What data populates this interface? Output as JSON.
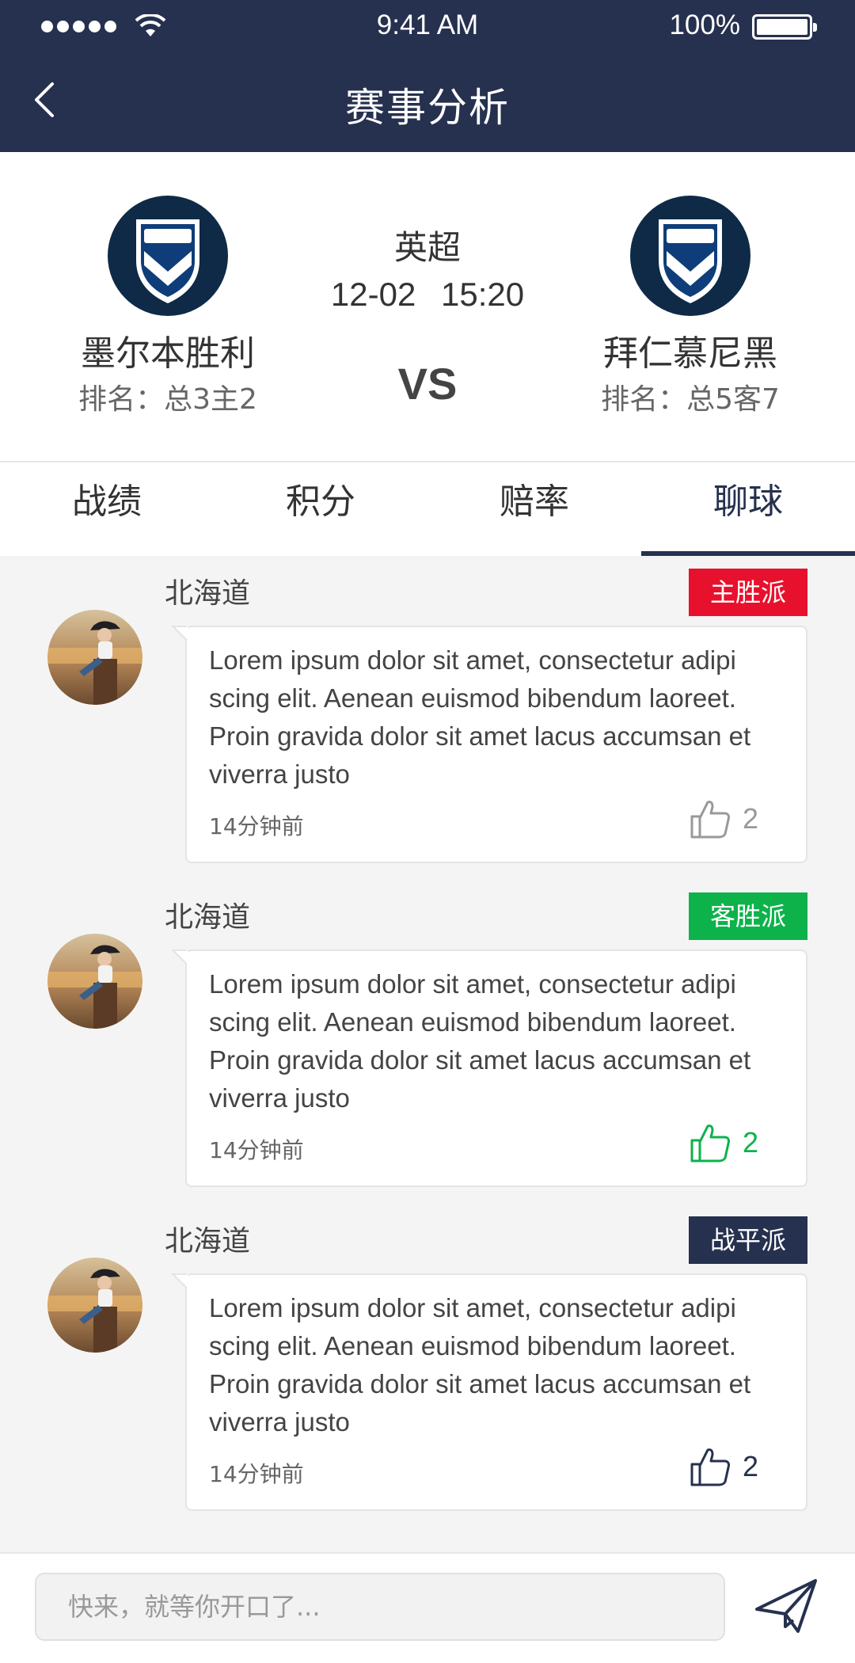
{
  "status_bar": {
    "time": "9:41 AM",
    "battery": "100%"
  },
  "nav": {
    "title": "赛事分析"
  },
  "match": {
    "league": "英超",
    "date": "12-02",
    "time": "15:20",
    "vs": "VS",
    "home": {
      "name": "墨尔本胜利",
      "rank": "排名：总3主2"
    },
    "away": {
      "name": "拜仁慕尼黑",
      "rank": "排名：总5客7"
    }
  },
  "tabs": [
    {
      "label": "战绩"
    },
    {
      "label": "积分"
    },
    {
      "label": "赔率"
    },
    {
      "label": "聊球",
      "active": true
    }
  ],
  "comments": [
    {
      "user": "北海道",
      "badge": "主胜派",
      "badge_color": "#e8112d",
      "text": "Lorem ipsum dolor sit amet, consectetur adipi scing elit. Aenean euismod bibendum laoreet. Proin gravida dolor sit amet lacus accumsan et viverra justo",
      "time": "14分钟前",
      "likes": "2",
      "like_color": "#999999"
    },
    {
      "user": "北海道",
      "badge": "客胜派",
      "badge_color": "#0eb24b",
      "text": "Lorem ipsum dolor sit amet, consectetur adipi scing elit. Aenean euismod bibendum laoreet. Proin gravida dolor sit amet lacus accumsan et viverra justo",
      "time": "14分钟前",
      "likes": "2",
      "like_color": "#0eb24b"
    },
    {
      "user": "北海道",
      "badge": "战平派",
      "badge_color": "#26314f",
      "text": "Lorem ipsum dolor sit amet, consectetur adipi scing elit. Aenean euismod bibendum laoreet. Proin gravida dolor sit amet lacus accumsan et viverra justo",
      "time": "14分钟前",
      "likes": "2",
      "like_color": "#26314f"
    }
  ],
  "input": {
    "placeholder": "快来，就等你开口了..."
  },
  "colors": {
    "header": "#26314f",
    "accent": "#26314f"
  }
}
